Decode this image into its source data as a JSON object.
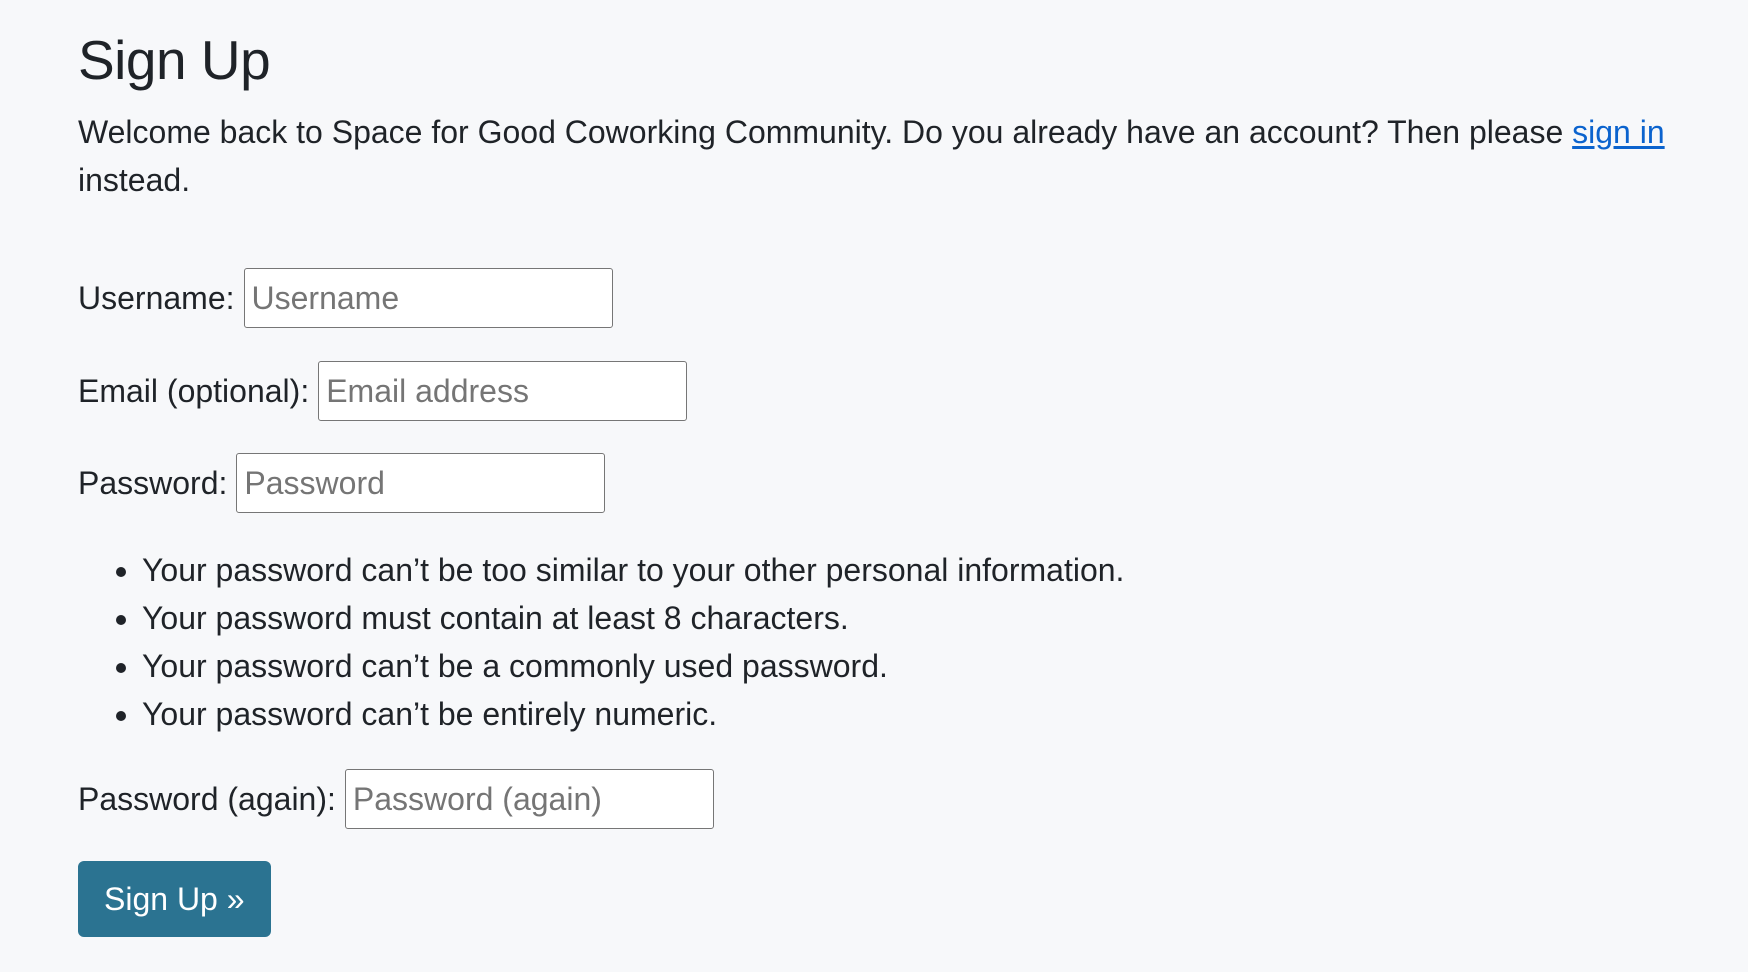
{
  "page": {
    "title": "Sign Up",
    "intro_text": "Welcome back to Space for Good Coworking Community. Do you already have an account? Then please ",
    "signin_link": "sign in",
    "intro_suffix": " instead."
  },
  "form": {
    "username": {
      "label": "Username:",
      "placeholder": "Username"
    },
    "email": {
      "label": "Email (optional):",
      "placeholder": "Email address"
    },
    "password": {
      "label": "Password:",
      "placeholder": "Password"
    },
    "password_help": [
      "Your password can’t be too similar to your other personal information.",
      "Your password must contain at least 8 characters.",
      "Your password can’t be a commonly used password.",
      "Your password can’t be entirely numeric."
    ],
    "password_again": {
      "label": "Password (again):",
      "placeholder": "Password (again)"
    },
    "submit_label": "Sign Up »"
  },
  "colors": {
    "background": "#f7f8fa",
    "link": "#0b63ce",
    "button": "#2b7391",
    "text": "#1f2328"
  }
}
